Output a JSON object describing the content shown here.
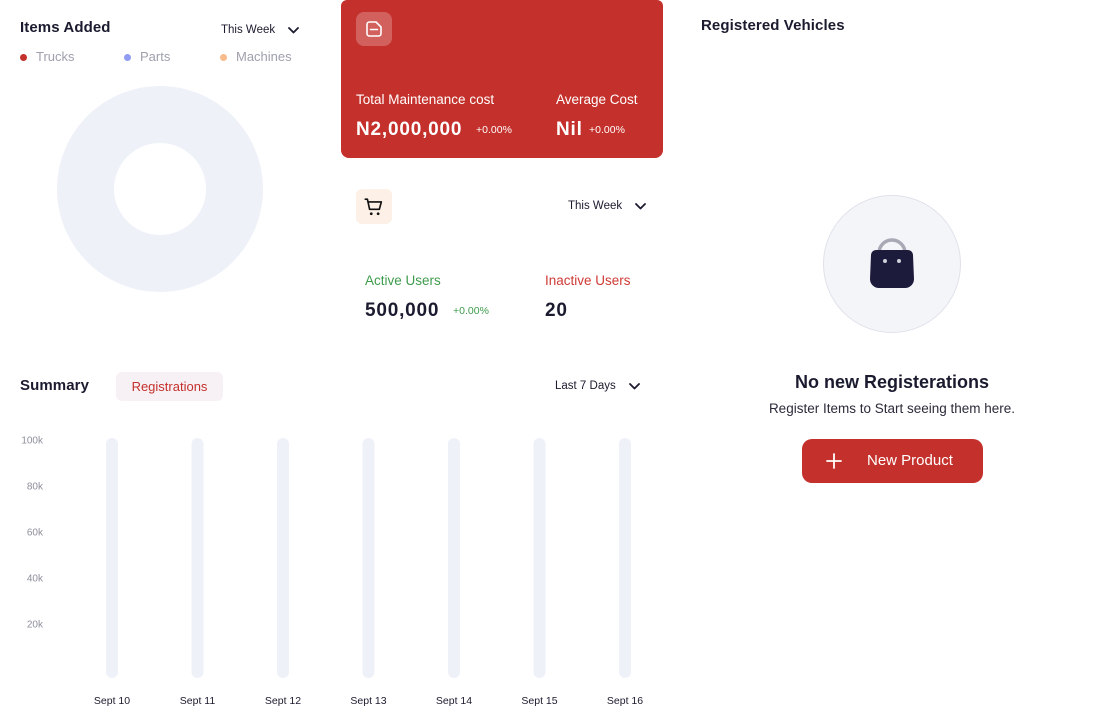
{
  "colors": {
    "accent": "#c4302b",
    "success": "#3e9b4c",
    "danger": "#cf3a35",
    "text": "#1b1b2f",
    "muted": "#9ea0ad",
    "track": "#eff1f9",
    "icon_bg_peach": "#fdf0e6"
  },
  "items_added": {
    "period": "This Week",
    "dropdown_icon": "chevron-down-icon"
  },
  "maintenance_card": {
    "icon": "document-icon",
    "total_label": "Total Maintenance cost",
    "total_value": "N2,000,000",
    "total_change": "+0.00%",
    "average_label": "Average Cost",
    "average_value": "Nil",
    "average_change": "+0.00%"
  },
  "users_card": {
    "icon": "cart-icon",
    "period": "This Week",
    "active_label": "Active Users",
    "active_value": "500,000",
    "active_change": "+0.00%",
    "inactive_label": "Inactive Users",
    "inactive_value": "20"
  },
  "summary": {
    "tab": "Registrations",
    "period": "Last 7 Days"
  },
  "registered_vehicles": {
    "title": "Registered Vehicles",
    "empty_icon": "shopping-bag-icon",
    "empty_title": "No new Registerations",
    "empty_text": "Register Items to Start seeing them here.",
    "button_icon": "plus-icon",
    "button_label": "New Product"
  },
  "chart_data": [
    {
      "type": "pie",
      "donut": true,
      "title": "Items Added",
      "categories": [
        "Trucks",
        "Parts",
        "Machines"
      ],
      "values": [
        0,
        0,
        0
      ],
      "colors": [
        "#c4302b",
        "#8f9cf2",
        "#f8bb8c"
      ],
      "legend": "top"
    },
    {
      "type": "bar",
      "title": "Summary",
      "categories": [
        "Sept 10",
        "Sept 11",
        "Sept 12",
        "Sept 13",
        "Sept 14",
        "Sept 15",
        "Sept 16"
      ],
      "series": [
        {
          "values": [
            0,
            0,
            0,
            0,
            0,
            0,
            0
          ]
        }
      ],
      "ylim": [
        0,
        100000
      ],
      "y_ticks": [
        100000,
        80000,
        60000,
        40000,
        20000
      ],
      "y_tick_labels": [
        "100k",
        "80k",
        "60k",
        "40k",
        "20k"
      ],
      "grid": false
    }
  ]
}
